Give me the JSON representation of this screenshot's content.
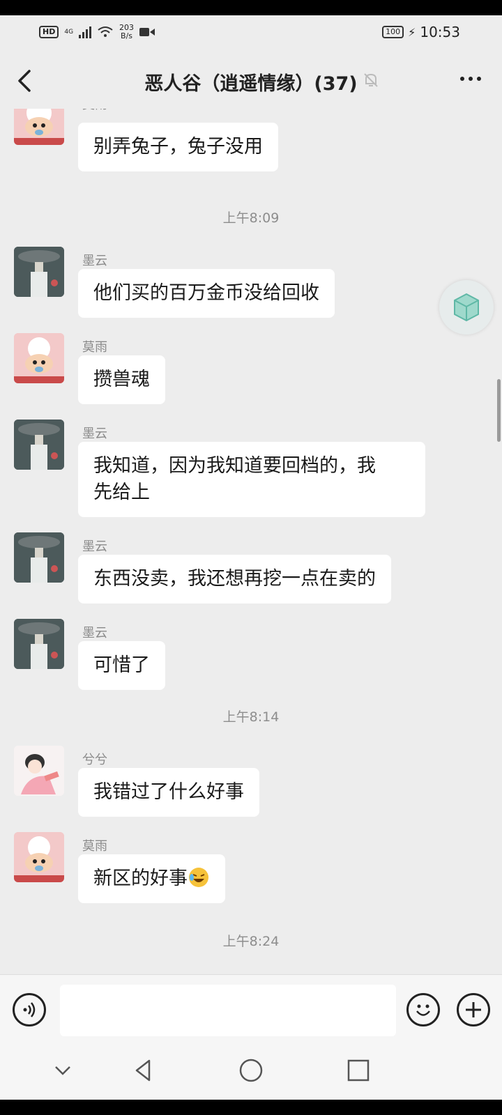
{
  "status_bar": {
    "hd": "HD",
    "network": "4G",
    "speed_value": "203",
    "speed_unit": "B/s",
    "battery": "100",
    "time": "10:53"
  },
  "header": {
    "title": "恶人谷（逍遥情缘）(37)"
  },
  "messages": [
    {
      "type": "message",
      "sender": "莫雨",
      "text": "别弄兔子，兔子没用",
      "avatar": "crayon-avatar"
    },
    {
      "type": "time",
      "text": "上午8:09"
    },
    {
      "type": "message",
      "sender": "墨云",
      "text": "他们买的百万金币没给回收",
      "avatar": "ink-avatar"
    },
    {
      "type": "message",
      "sender": "莫雨",
      "text": "攒兽魂",
      "avatar": "crayon-avatar"
    },
    {
      "type": "message",
      "sender": "墨云",
      "text_line1": "我知道，因为我知道要回档的，我",
      "text_line2": "先给上",
      "avatar": "ink-avatar"
    },
    {
      "type": "message",
      "sender": "墨云",
      "text": "东西没卖，我还想再挖一点在卖的",
      "avatar": "ink-avatar"
    },
    {
      "type": "message",
      "sender": "墨云",
      "text": "可惜了",
      "avatar": "ink-avatar"
    },
    {
      "type": "time",
      "text": "上午8:14"
    },
    {
      "type": "message",
      "sender": "兮兮",
      "text": "我错过了什么好事",
      "avatar": "girl-avatar"
    },
    {
      "type": "message",
      "sender": "莫雨",
      "text": "新区的好事",
      "emoji": "laughing-emoji",
      "avatar": "crayon-avatar"
    },
    {
      "type": "time",
      "text": "上午8:24"
    }
  ],
  "input": {
    "placeholder": ""
  },
  "colors": {
    "background": "#ededed",
    "bubble": "#ffffff",
    "text": "#1a1a1a",
    "meta": "#8d8d8d"
  }
}
